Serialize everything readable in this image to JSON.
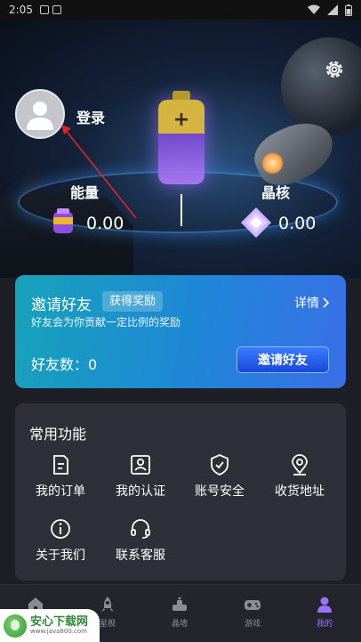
{
  "status_bar": {
    "time": "2:05"
  },
  "profile": {
    "login_label": "登录"
  },
  "stats": {
    "energy": {
      "label": "能量",
      "value": "0.00"
    },
    "crystal": {
      "label": "晶核",
      "value": "0.00"
    }
  },
  "invite": {
    "title": "邀请好友",
    "badge": "获得奖励",
    "details": "详情",
    "description": "好友会为你贡献一定比例的奖励",
    "count_text": "好友数：0",
    "button": "邀请好友"
  },
  "functions": {
    "heading": "常用功能",
    "items": [
      {
        "label": "我的订单",
        "icon": "order-icon"
      },
      {
        "label": "我的认证",
        "icon": "id-card-icon"
      },
      {
        "label": "账号安全",
        "icon": "shield-icon"
      },
      {
        "label": "收货地址",
        "icon": "location-icon"
      },
      {
        "label": "关于我们",
        "icon": "info-icon"
      },
      {
        "label": "联系客服",
        "icon": "headset-icon"
      }
    ]
  },
  "tabs": [
    {
      "label": "",
      "icon": "home-icon"
    },
    {
      "label": "星舰",
      "icon": "rocket-icon"
    },
    {
      "label": "晶墙",
      "icon": "base-icon"
    },
    {
      "label": "游戏",
      "icon": "gamepad-icon"
    },
    {
      "label": "我的",
      "icon": "user-icon",
      "active": true
    }
  ],
  "watermark": {
    "brand": "安心下载网",
    "url": "www.java800.com"
  },
  "colors": {
    "accent": "#9a72ff",
    "invite_start": "#17a3b9",
    "invite_end": "#3a6fe7"
  }
}
